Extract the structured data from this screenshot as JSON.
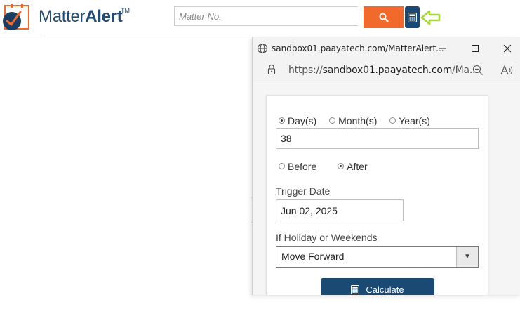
{
  "header": {
    "logo_text_light": "Matter",
    "logo_text_bold": "Alert",
    "logo_trademark": "TM",
    "search_placeholder": "Matter No.",
    "search_icon": "search-icon",
    "calculator_icon": "calculator-icon",
    "arrow_icon": "arrow-left-icon",
    "colors": {
      "brand": "#244b73",
      "search_button": "#f26a2b",
      "calc_button": "#1a4a73",
      "arrow": "#a6d63a"
    }
  },
  "popup": {
    "window_title": "sandbox01.paayatech.com/MatterAlert...",
    "url_prefix": "https://",
    "url_host": "sandbox01.paayatech.com",
    "url_rest": "/Ma...",
    "form": {
      "unit_options": [
        {
          "label": "Day(s)",
          "checked": true
        },
        {
          "label": "Month(s)",
          "checked": false
        },
        {
          "label": "Year(s)",
          "checked": false
        }
      ],
      "count_value": "38",
      "direction_options": [
        {
          "label": "Before",
          "checked": false
        },
        {
          "label": "After",
          "checked": true
        }
      ],
      "trigger_label": "Trigger Date",
      "trigger_value": "Jun 02, 2025",
      "holiday_label": "If Holiday or Weekends",
      "holiday_value": "Move Forward",
      "calculate_label": "Calculate"
    }
  }
}
